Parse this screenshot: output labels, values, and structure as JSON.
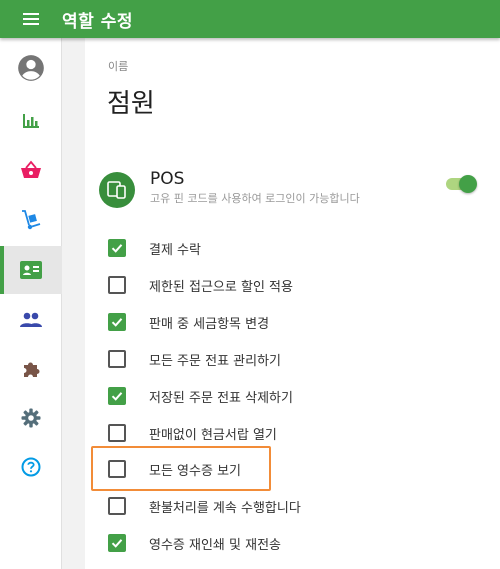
{
  "header": {
    "title": "역할 수정",
    "menu_icon": "hamburger-icon"
  },
  "sidebar": {
    "items": [
      {
        "icon": "account-circle-icon",
        "active": false,
        "color": "#757575"
      },
      {
        "icon": "bar-chart-icon",
        "active": false,
        "color": "#43a047"
      },
      {
        "icon": "basket-icon",
        "active": false,
        "color": "#e91e63"
      },
      {
        "icon": "hand-truck-icon",
        "active": false,
        "color": "#1e88e5"
      },
      {
        "icon": "id-card-icon",
        "active": true,
        "color": "#43a047"
      },
      {
        "icon": "people-icon",
        "active": false,
        "color": "#3949ab"
      },
      {
        "icon": "puzzle-icon",
        "active": false,
        "color": "#795548"
      },
      {
        "icon": "gear-icon",
        "active": false,
        "color": "#546e7a"
      },
      {
        "icon": "help-icon",
        "active": false,
        "color": "#039be5"
      }
    ]
  },
  "form": {
    "name_label": "이름",
    "name_value": "점원"
  },
  "pos": {
    "title": "POS",
    "description": "고유 핀 코드를 사용하여 로그인이 가능합니다",
    "enabled": true
  },
  "permissions": [
    {
      "label": "결제 수락",
      "checked": true
    },
    {
      "label": "제한된 접근으로 할인 적용",
      "checked": false
    },
    {
      "label": "판매 중 세금항목 변경",
      "checked": true
    },
    {
      "label": "모든 주문 전표 관리하기",
      "checked": false
    },
    {
      "label": "저장된 주문 전표 삭제하기",
      "checked": true
    },
    {
      "label": "판매없이 현금서랍 열기",
      "checked": false
    },
    {
      "label": "모든 영수증 보기",
      "checked": false
    },
    {
      "label": "환불처리를 계속 수행합니다",
      "checked": false
    },
    {
      "label": "영수증 재인쇄 및 재전송",
      "checked": true
    }
  ],
  "colors": {
    "primary": "#43a047",
    "highlight": "#f28c38"
  }
}
